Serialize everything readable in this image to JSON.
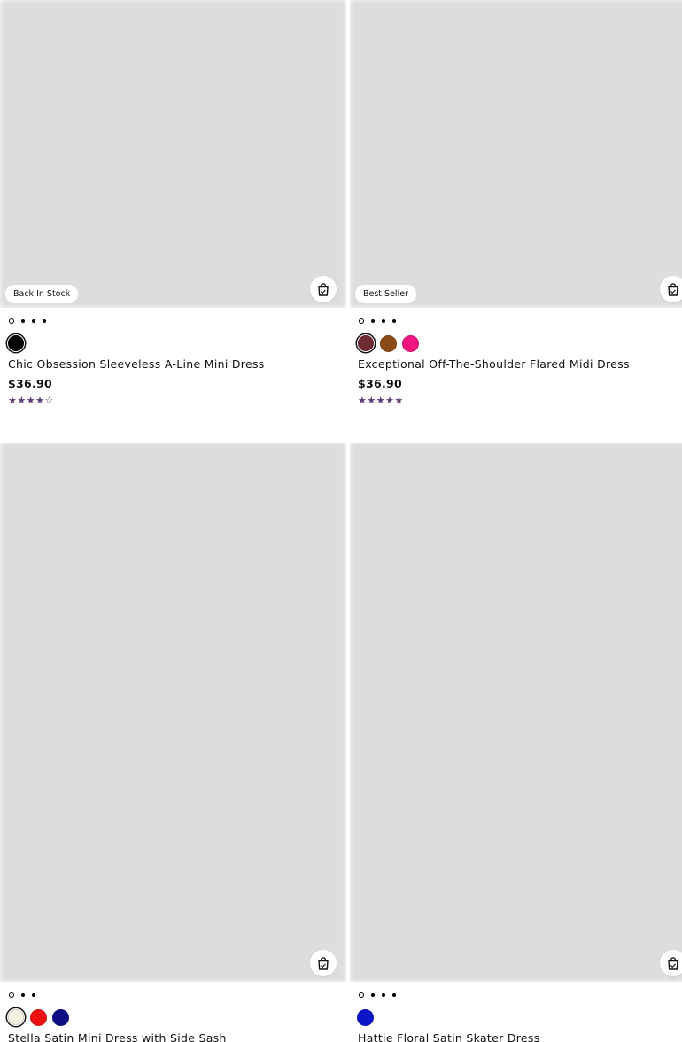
{
  "icons": {
    "quick_add": "shopping-bag-icon",
    "star": "star-icon"
  },
  "products": [
    {
      "badge": "Back In Stock",
      "image_count": 4,
      "active_image": 0,
      "colors": [
        "#000000"
      ],
      "selected_color": 0,
      "name": "Chic Obsession Sleeveless A-Line Mini Dress",
      "price": "$36.90",
      "rating": 4.5,
      "rating_color": "#5b3a73"
    },
    {
      "badge": "Best Seller",
      "image_count": 4,
      "active_image": 0,
      "colors": [
        "#6e2b32",
        "#8b4a17",
        "#f0147f"
      ],
      "selected_color": 0,
      "name": "Exceptional Off-The-Shoulder Flared Midi Dress",
      "price": "$36.90",
      "rating": 5,
      "rating_color": "#5b3a73"
    },
    {
      "badge": "",
      "image_count": 3,
      "active_image": 0,
      "colors": [
        "#f6f1e3",
        "#ee1111",
        "#0e0e85"
      ],
      "selected_color": 0,
      "name": "Stella Satin Mini Dress with Side Sash",
      "price": "",
      "rating": null
    },
    {
      "badge": "",
      "image_count": 4,
      "active_image": 0,
      "colors": [
        "#0d15c8"
      ],
      "selected_color": null,
      "name": "Hattie Floral Satin Skater Dress",
      "price": "",
      "rating": null
    }
  ]
}
